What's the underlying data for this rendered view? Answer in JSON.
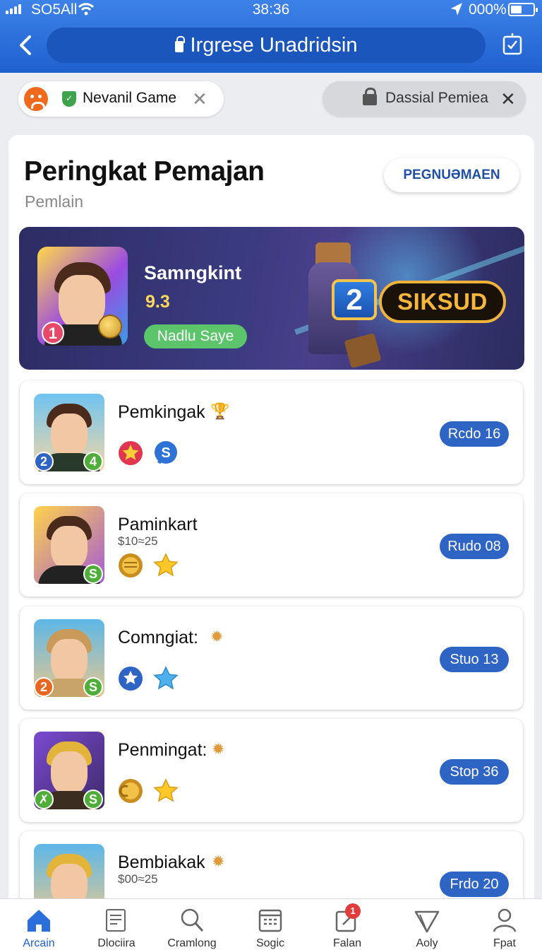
{
  "status_bar": {
    "carrier": "SO5All",
    "time": "38:36",
    "battery": "000%"
  },
  "browser": {
    "url": "Irgrese Unadridsin"
  },
  "tabs": [
    {
      "label": "Nevanil Game"
    },
    {
      "label": "Dassial Pemiea"
    }
  ],
  "page": {
    "title": "Peringkat Pemajan",
    "subtitle": "Pemlain",
    "action_button": "PEGNUƏMAEN"
  },
  "hero": {
    "rank": "1",
    "name": "Samngkint",
    "score": "9.3",
    "tag": "Nadlu Saye",
    "rank_badge": "2",
    "cta": "SIKSUD"
  },
  "leaderboard": [
    {
      "name": "Pemkingak",
      "price": "",
      "button": "Rcdo 16",
      "badges": [
        "2",
        "4"
      ]
    },
    {
      "name": "Paminkart",
      "price": "$10≈25",
      "button": "Rudo 08",
      "badges": [
        "S"
      ]
    },
    {
      "name": "Comngiat:",
      "price": "",
      "button": "Stuo 13",
      "badges": [
        "2",
        "S"
      ]
    },
    {
      "name": "Penmingat:",
      "price": "",
      "button": "Stop 36",
      "badges": [
        "✗",
        "S"
      ]
    },
    {
      "name": "Bembiakak",
      "price": "$00≈25",
      "button": "Frdo 20",
      "badges": []
    }
  ],
  "bottom_nav": [
    {
      "label": "Arcain",
      "icon": "home-icon",
      "active": true
    },
    {
      "label": "Dlociira",
      "icon": "document-icon",
      "active": false
    },
    {
      "label": "Cramlong",
      "icon": "search-icon",
      "active": false
    },
    {
      "label": "Sogic",
      "icon": "calendar-icon",
      "active": false
    },
    {
      "label": "Falan",
      "icon": "edit-icon",
      "active": false,
      "notification": "1"
    },
    {
      "label": "Aoly",
      "icon": "send-icon",
      "active": false
    },
    {
      "label": "Fpat",
      "icon": "profile-icon",
      "active": false
    }
  ],
  "colors": {
    "header": "#2a6fdc",
    "accent": "#2e64c3",
    "hero_bg": "#2c2d63",
    "tag_green": "#5cc46a",
    "gold": "#f0b33a"
  }
}
